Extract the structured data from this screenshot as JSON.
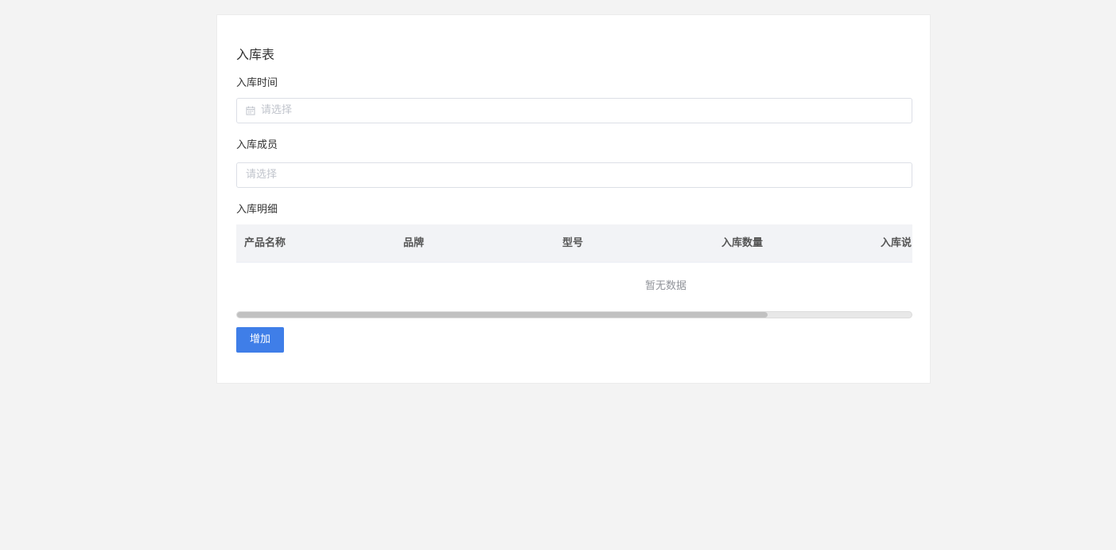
{
  "form": {
    "title": "入库表",
    "time_label": "入库时间",
    "time_placeholder": "请选择",
    "member_label": "入库成员",
    "member_placeholder": "请选择",
    "detail_label": "入库明细"
  },
  "table": {
    "columns": [
      "产品名称",
      "品牌",
      "型号",
      "入库数量",
      "入库说"
    ],
    "empty_text": "暂无数据",
    "scroll_fraction": 0.787
  },
  "actions": {
    "add_label": "增加",
    "add_color": "#3f7ee8"
  },
  "icons": {
    "time_field_icon": "calendar-icon"
  }
}
